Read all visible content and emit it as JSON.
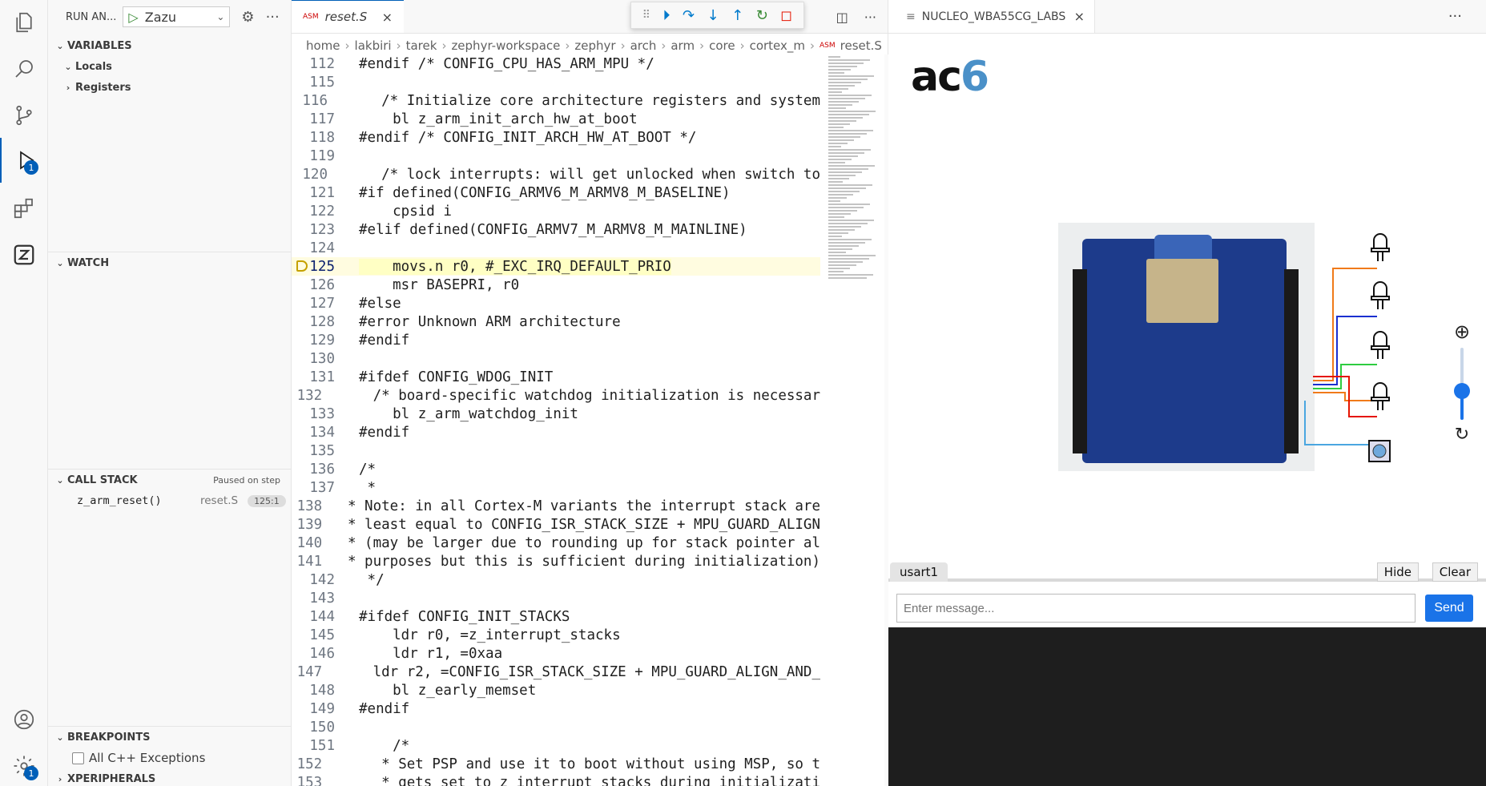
{
  "activity": {
    "debug_badge": "1",
    "settings_badge": "1"
  },
  "sidebar": {
    "run_title": "RUN AN...",
    "config": "Zazu",
    "variables_title": "VARIABLES",
    "locals": "Locals",
    "registers": "Registers",
    "watch_title": "WATCH",
    "callstack_title": "CALL STACK",
    "paused": "Paused on step",
    "stack_frames": [
      {
        "fn": "z_arm_reset()",
        "file": "reset.S",
        "pos": "125:1"
      }
    ],
    "breakpoints_title": "BREAKPOINTS",
    "bp_all_cpp": "All C++ Exceptions",
    "xperipherals": "XPERIPHERALS"
  },
  "editor": {
    "tab_badge": "ASM",
    "tab_label": "reset.S",
    "breadcrumb": [
      "home",
      "lakbiri",
      "tarek",
      "zephyr-workspace",
      "zephyr",
      "arch",
      "arm",
      "core",
      "cortex_m"
    ],
    "breadcrumb_file_badge": "ASM",
    "breadcrumb_file": "reset.S",
    "current_line": 125,
    "lines": [
      {
        "n": "112",
        "t": "#endif /* CONFIG_CPU_HAS_ARM_MPU */"
      },
      {
        "n": "115",
        "t": ""
      },
      {
        "n": "116",
        "t": "    /* Initialize core architecture registers and system"
      },
      {
        "n": "117",
        "t": "    bl z_arm_init_arch_hw_at_boot"
      },
      {
        "n": "118",
        "t": "#endif /* CONFIG_INIT_ARCH_HW_AT_BOOT */"
      },
      {
        "n": "119",
        "t": ""
      },
      {
        "n": "120",
        "t": "    /* lock interrupts: will get unlocked when switch to"
      },
      {
        "n": "121",
        "t": "#if defined(CONFIG_ARMV6_M_ARMV8_M_BASELINE)"
      },
      {
        "n": "122",
        "t": "    cpsid i"
      },
      {
        "n": "123",
        "t": "#elif defined(CONFIG_ARMV7_M_ARMV8_M_MAINLINE)"
      },
      {
        "n": "124",
        "t": ""
      },
      {
        "n": "125",
        "t": "    movs.n r0, #_EXC_IRQ_DEFAULT_PRIO"
      },
      {
        "n": "126",
        "t": "    msr BASEPRI, r0"
      },
      {
        "n": "127",
        "t": "#else"
      },
      {
        "n": "128",
        "t": "#error Unknown ARM architecture"
      },
      {
        "n": "129",
        "t": "#endif"
      },
      {
        "n": "130",
        "t": ""
      },
      {
        "n": "131",
        "t": "#ifdef CONFIG_WDOG_INIT"
      },
      {
        "n": "132",
        "t": "    /* board-specific watchdog initialization is necessar"
      },
      {
        "n": "133",
        "t": "    bl z_arm_watchdog_init"
      },
      {
        "n": "134",
        "t": "#endif"
      },
      {
        "n": "135",
        "t": ""
      },
      {
        "n": "136",
        "t": "/*"
      },
      {
        "n": "137",
        "t": " *"
      },
      {
        "n": "138",
        "t": " * Note: in all Cortex-M variants the interrupt stack are"
      },
      {
        "n": "139",
        "t": " * least equal to CONFIG_ISR_STACK_SIZE + MPU_GUARD_ALIGN"
      },
      {
        "n": "140",
        "t": " * (may be larger due to rounding up for stack pointer al"
      },
      {
        "n": "141",
        "t": " * purposes but this is sufficient during initialization)"
      },
      {
        "n": "142",
        "t": " */"
      },
      {
        "n": "143",
        "t": ""
      },
      {
        "n": "144",
        "t": "#ifdef CONFIG_INIT_STACKS"
      },
      {
        "n": "145",
        "t": "    ldr r0, =z_interrupt_stacks"
      },
      {
        "n": "146",
        "t": "    ldr r1, =0xaa"
      },
      {
        "n": "147",
        "t": "    ldr r2, =CONFIG_ISR_STACK_SIZE + MPU_GUARD_ALIGN_AND_"
      },
      {
        "n": "148",
        "t": "    bl z_early_memset"
      },
      {
        "n": "149",
        "t": "#endif"
      },
      {
        "n": "150",
        "t": ""
      },
      {
        "n": "151",
        "t": "    /*"
      },
      {
        "n": "152",
        "t": "     * Set PSP and use it to boot without using MSP, so t"
      },
      {
        "n": "153",
        "t": "     * gets set to z_interrupt_stacks during initializati"
      }
    ]
  },
  "panel": {
    "tab_label": "NUCLEO_WBA55CG_LABS",
    "console_tab": "usart1",
    "hide": "Hide",
    "clear": "Clear",
    "msg_placeholder": "Enter message...",
    "send": "Send",
    "zoom_level": 0.4
  },
  "colors": {
    "accent": "#005fb8",
    "send": "#1a73e8",
    "current_line": "#ffffc4"
  }
}
